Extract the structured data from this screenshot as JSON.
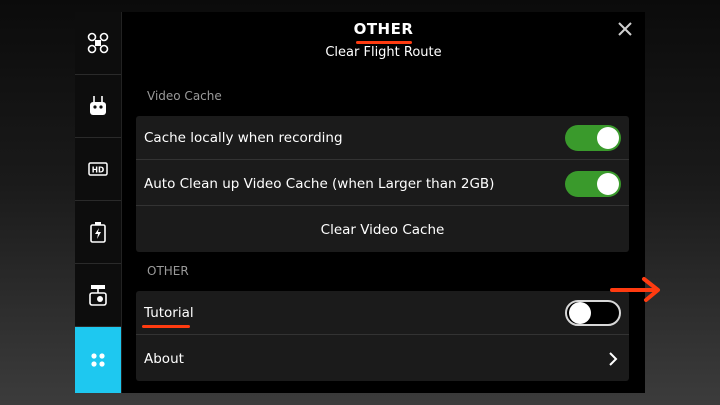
{
  "header": {
    "title": "OTHER",
    "subtitle": "Clear Flight Route"
  },
  "sidebar": {
    "items": [
      {
        "icon": "aircraft-icon"
      },
      {
        "icon": "remote-controller-icon"
      },
      {
        "icon": "hd-transmission-icon"
      },
      {
        "icon": "battery-icon"
      },
      {
        "icon": "gimbal-camera-icon"
      },
      {
        "icon": "general-settings-icon",
        "active": true
      }
    ]
  },
  "video_cache": {
    "section_label": "Video Cache",
    "cache_locally_label": "Cache locally when recording",
    "cache_locally_on": true,
    "auto_clean_label": "Auto Clean up Video Cache (when Larger than 2GB)",
    "auto_clean_on": true,
    "clear_cache_label": "Clear Video Cache"
  },
  "other": {
    "section_label": "OTHER",
    "tutorial_label": "Tutorial",
    "tutorial_on": false,
    "about_label": "About"
  },
  "colors": {
    "accent": "#1ec8f0",
    "toggle_on": "#3a9a2c",
    "annotation": "#ff3b10"
  }
}
